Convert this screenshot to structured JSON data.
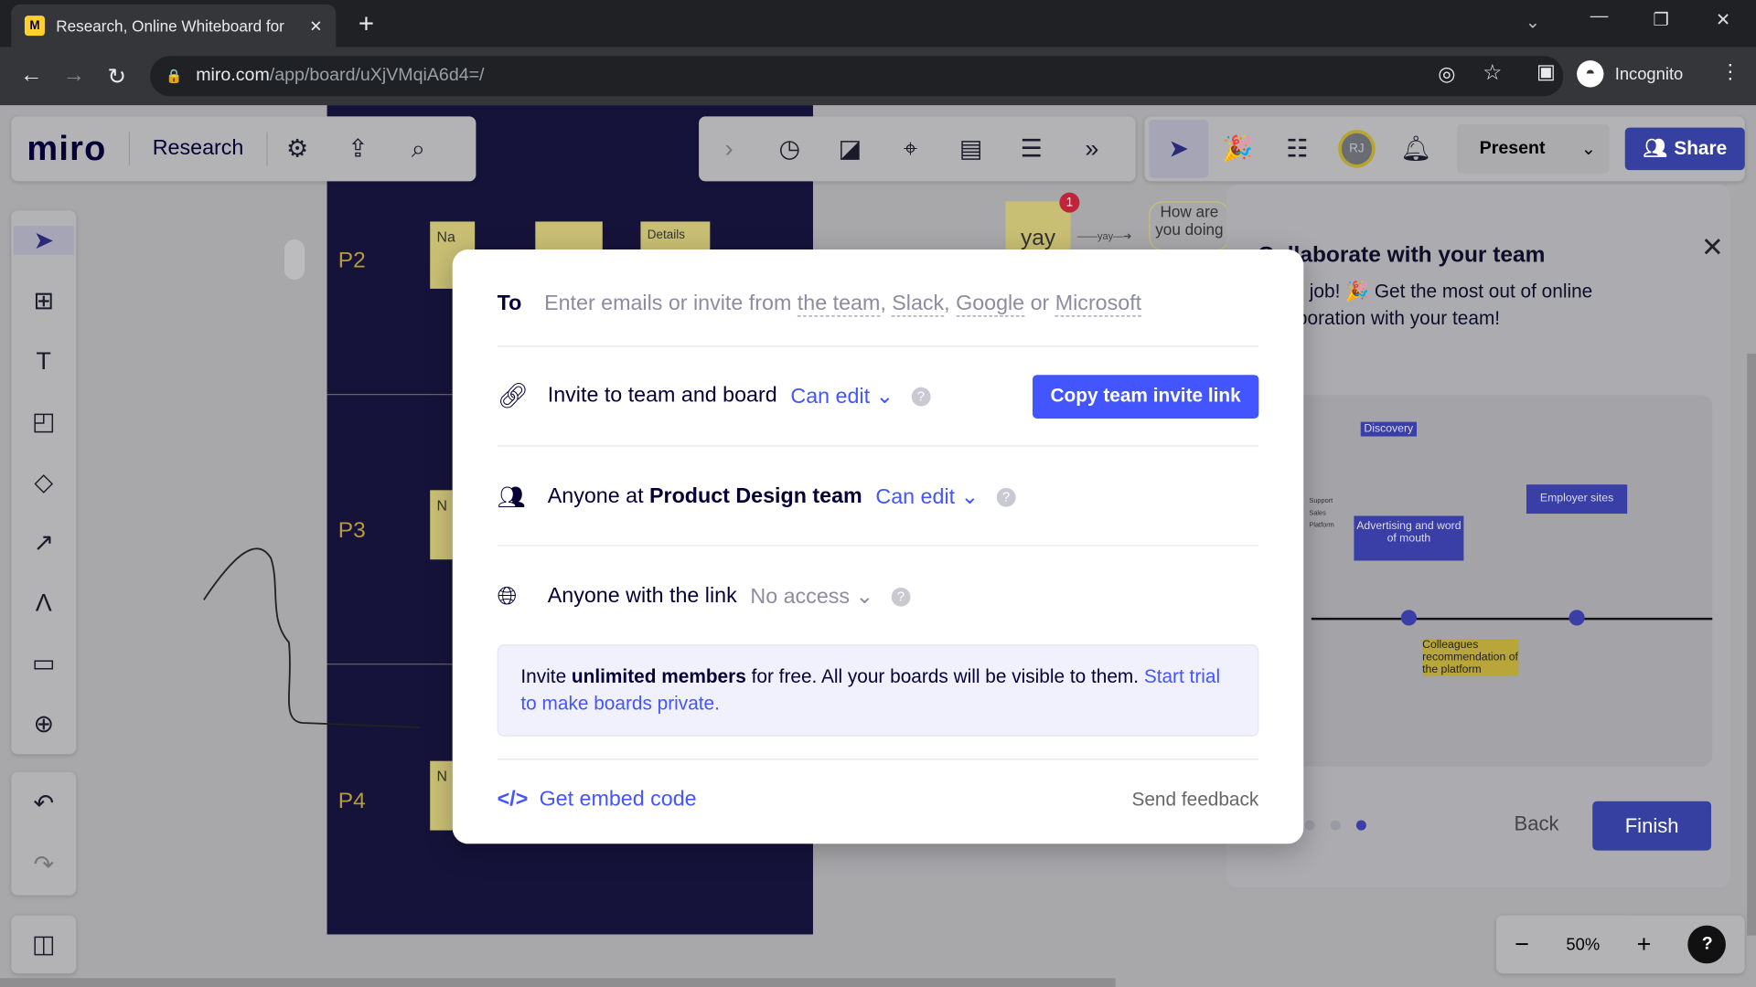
{
  "browser": {
    "tab_title": "Research, Online Whiteboard for",
    "url_domain": "miro.com",
    "url_path": "/app/board/uXjVMqiA6d4=/",
    "profile": "Incognito"
  },
  "app": {
    "logo": "miro",
    "board_name": "Research",
    "present_label": "Present",
    "share_label": "Share",
    "avatar_initials": "RJ",
    "zoom_level": "50%",
    "accent": "#4255ff"
  },
  "board": {
    "rows": [
      "P2",
      "P3",
      "P4"
    ],
    "sticky_details": "Details",
    "sticky_na": "Na",
    "sticky_n": "N",
    "yay": "yay",
    "arrow_label": "yay",
    "bubble_text": "How are you doing",
    "badge_count": "1"
  },
  "share_modal": {
    "to_label": "To",
    "to_placeholder_prefix": "Enter emails or invite from ",
    "to_team": "the team",
    "to_slack": "Slack",
    "to_google": "Google",
    "to_or": " or ",
    "to_microsoft": "Microsoft",
    "invite_label": "Invite to team and board",
    "invite_perm": "Can edit",
    "copy_button": "Copy team invite link",
    "anyone_at_prefix": "Anyone at ",
    "team_name": "Product Design team",
    "team_perm": "Can edit",
    "link_label": "Anyone with the link",
    "link_perm": "No access",
    "info_1": "Invite ",
    "info_bold": "unlimited members",
    "info_2": " for free. All your boards will be visible to them. ",
    "info_link": "Start trial to make boards private.",
    "embed": "Get embed code",
    "feedback": "Send feedback"
  },
  "onboarding": {
    "title": "Collaborate with your team",
    "body": "Good job! 🎉 Get the most out of online collaboration with your team!",
    "back": "Back",
    "finish": "Finish",
    "step": 3,
    "steps": 3,
    "preview": {
      "discovery": "Discovery",
      "support": "Support",
      "sales": "Sales",
      "platform": "Platform",
      "adv": "Advertising and word of mouth",
      "employer": "Employer sites",
      "colleagues": "Colleagues recommendation of the platform"
    }
  }
}
